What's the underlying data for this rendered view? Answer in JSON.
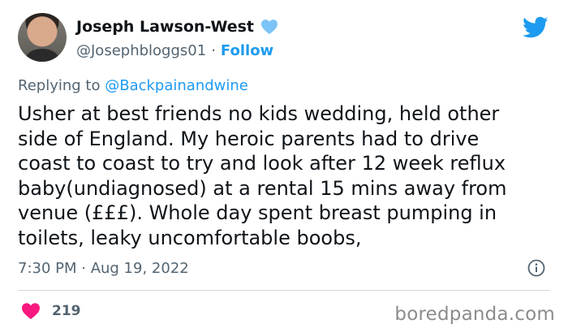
{
  "author": {
    "display_name": "Joseph Lawson-West",
    "handle": "@Josephbloggs01",
    "separator": "·",
    "follow_label": "Follow"
  },
  "reply": {
    "prefix": "Replying to",
    "mention": "@Backpainandwine"
  },
  "tweet": {
    "text": "Usher at best friends no kids wedding, held other\nside of England. My heroic parents had to drive\ncoast to coast to try and look after 12 week reflux\nbaby(undiagnosed) at a rental 15 mins away from\nvenue (£££). Whole day spent breast pumping in\ntoilets, leaky uncomfortable boobs,",
    "timestamp": "7:30 PM · Aug 19, 2022",
    "likes": "219"
  },
  "watermark": "boredpanda.com",
  "icons": {
    "verified_badge": "blue-heart-icon",
    "brand": "twitter-bird-icon",
    "info": "info-icon",
    "like": "heart-icon"
  },
  "colors": {
    "link_blue": "#1d9bf0",
    "secondary_text": "#536471",
    "like_pink": "#f91880",
    "heart_badge": "#7cc4f5"
  }
}
